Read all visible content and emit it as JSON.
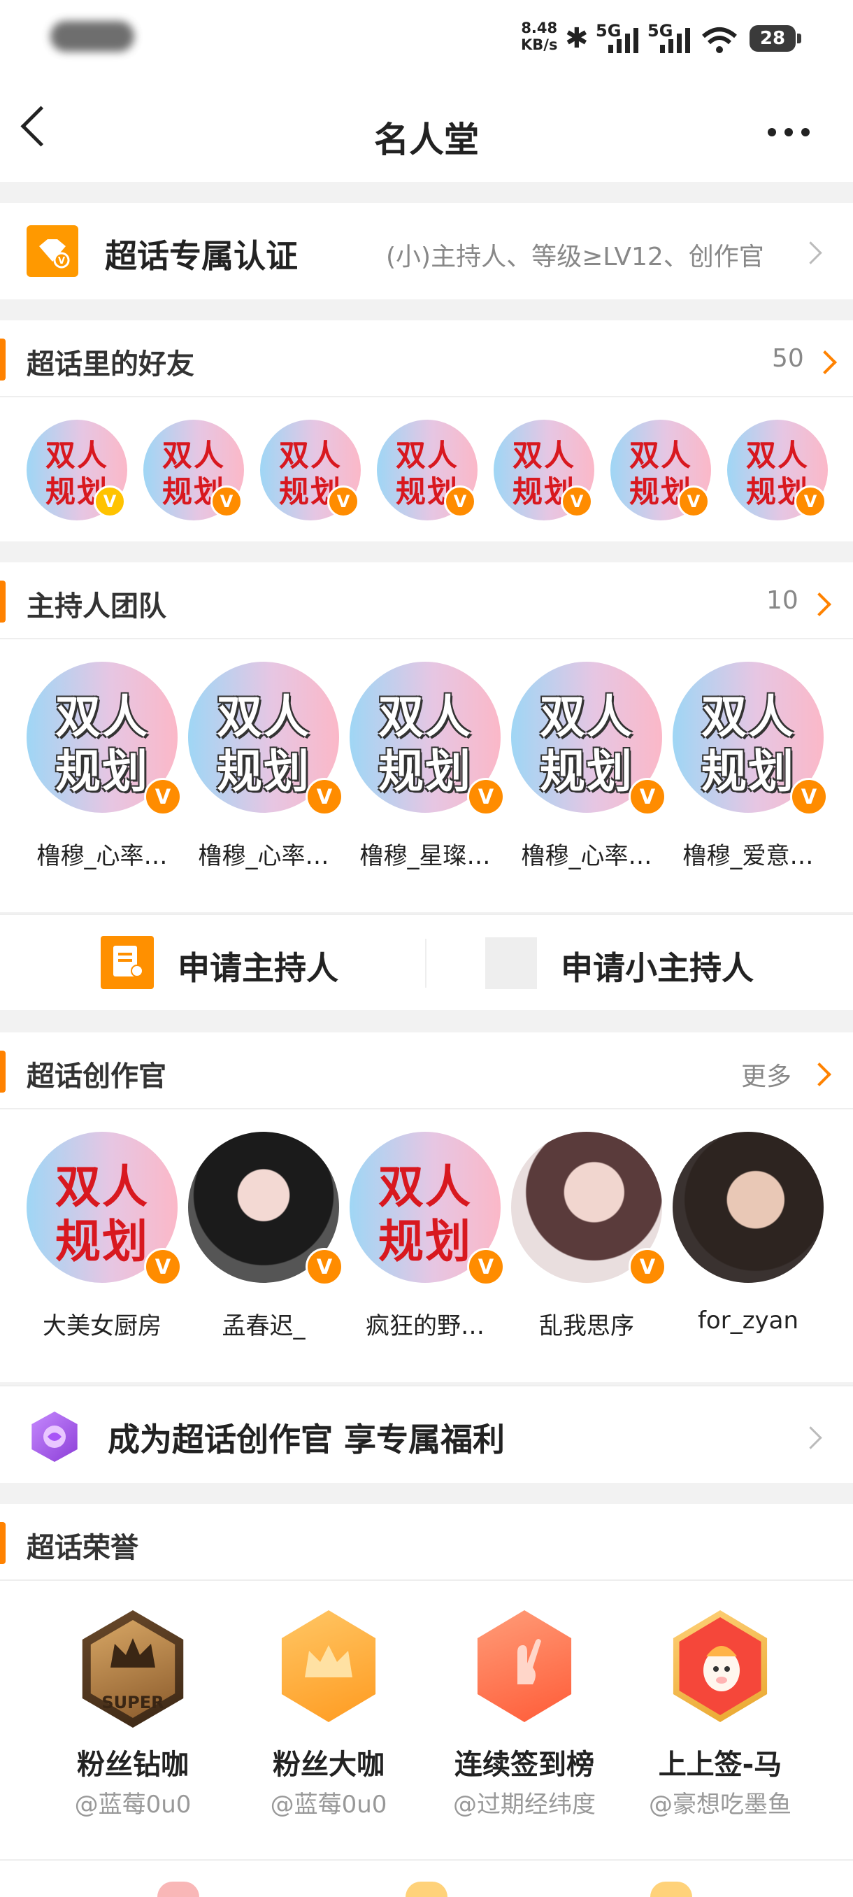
{
  "status_bar": {
    "speed_value": "8.48",
    "speed_unit": "KB/s",
    "network1": "5G",
    "network2": "5G",
    "battery": "28"
  },
  "header": {
    "title": "名人堂",
    "back_icon": "back-icon",
    "more_icon": "more-icon"
  },
  "cert": {
    "title": "超话专属认证",
    "desc": "(小)主持人、等级≥LV12、创作官",
    "icon": "verified-shield-icon",
    "color": "#ff9900"
  },
  "friends": {
    "title": "超话里的好友",
    "count": "50",
    "avatar_line1": "双人",
    "avatar_line2": "规划",
    "badge": "V"
  },
  "hosts": {
    "title": "主持人团队",
    "count": "10",
    "members": [
      {
        "name": "橹穆_心率…"
      },
      {
        "name": "橹穆_心率…"
      },
      {
        "name": "橹穆_星璨…"
      },
      {
        "name": "橹穆_心率…"
      },
      {
        "name": "橹穆_爱意…"
      }
    ]
  },
  "apply": {
    "host_label": "申请主持人",
    "small_host_label": "申请小主持人"
  },
  "creators": {
    "title": "超话创作官",
    "more_label": "更多",
    "members": [
      {
        "name": "大美女厨房"
      },
      {
        "name": "孟春迟_"
      },
      {
        "name": "疯狂的野…"
      },
      {
        "name": "乱我思序"
      },
      {
        "name": "for_zyan"
      }
    ]
  },
  "become_creator": {
    "label": "成为超话创作官 享专属福利"
  },
  "honors": {
    "title": "超话荣誉",
    "super_text": "SUPER",
    "items": [
      {
        "name": "粉丝钻咖",
        "user": "@蓝莓0u0"
      },
      {
        "name": "粉丝大咖",
        "user": "@蓝莓0u0"
      },
      {
        "name": "连续签到榜",
        "user": "@过期经纬度"
      },
      {
        "name": "上上签-马",
        "user": "@豪想吃墨鱼"
      }
    ]
  },
  "colors": {
    "accent": "#ff8200",
    "bg": "#f2f2f2"
  }
}
